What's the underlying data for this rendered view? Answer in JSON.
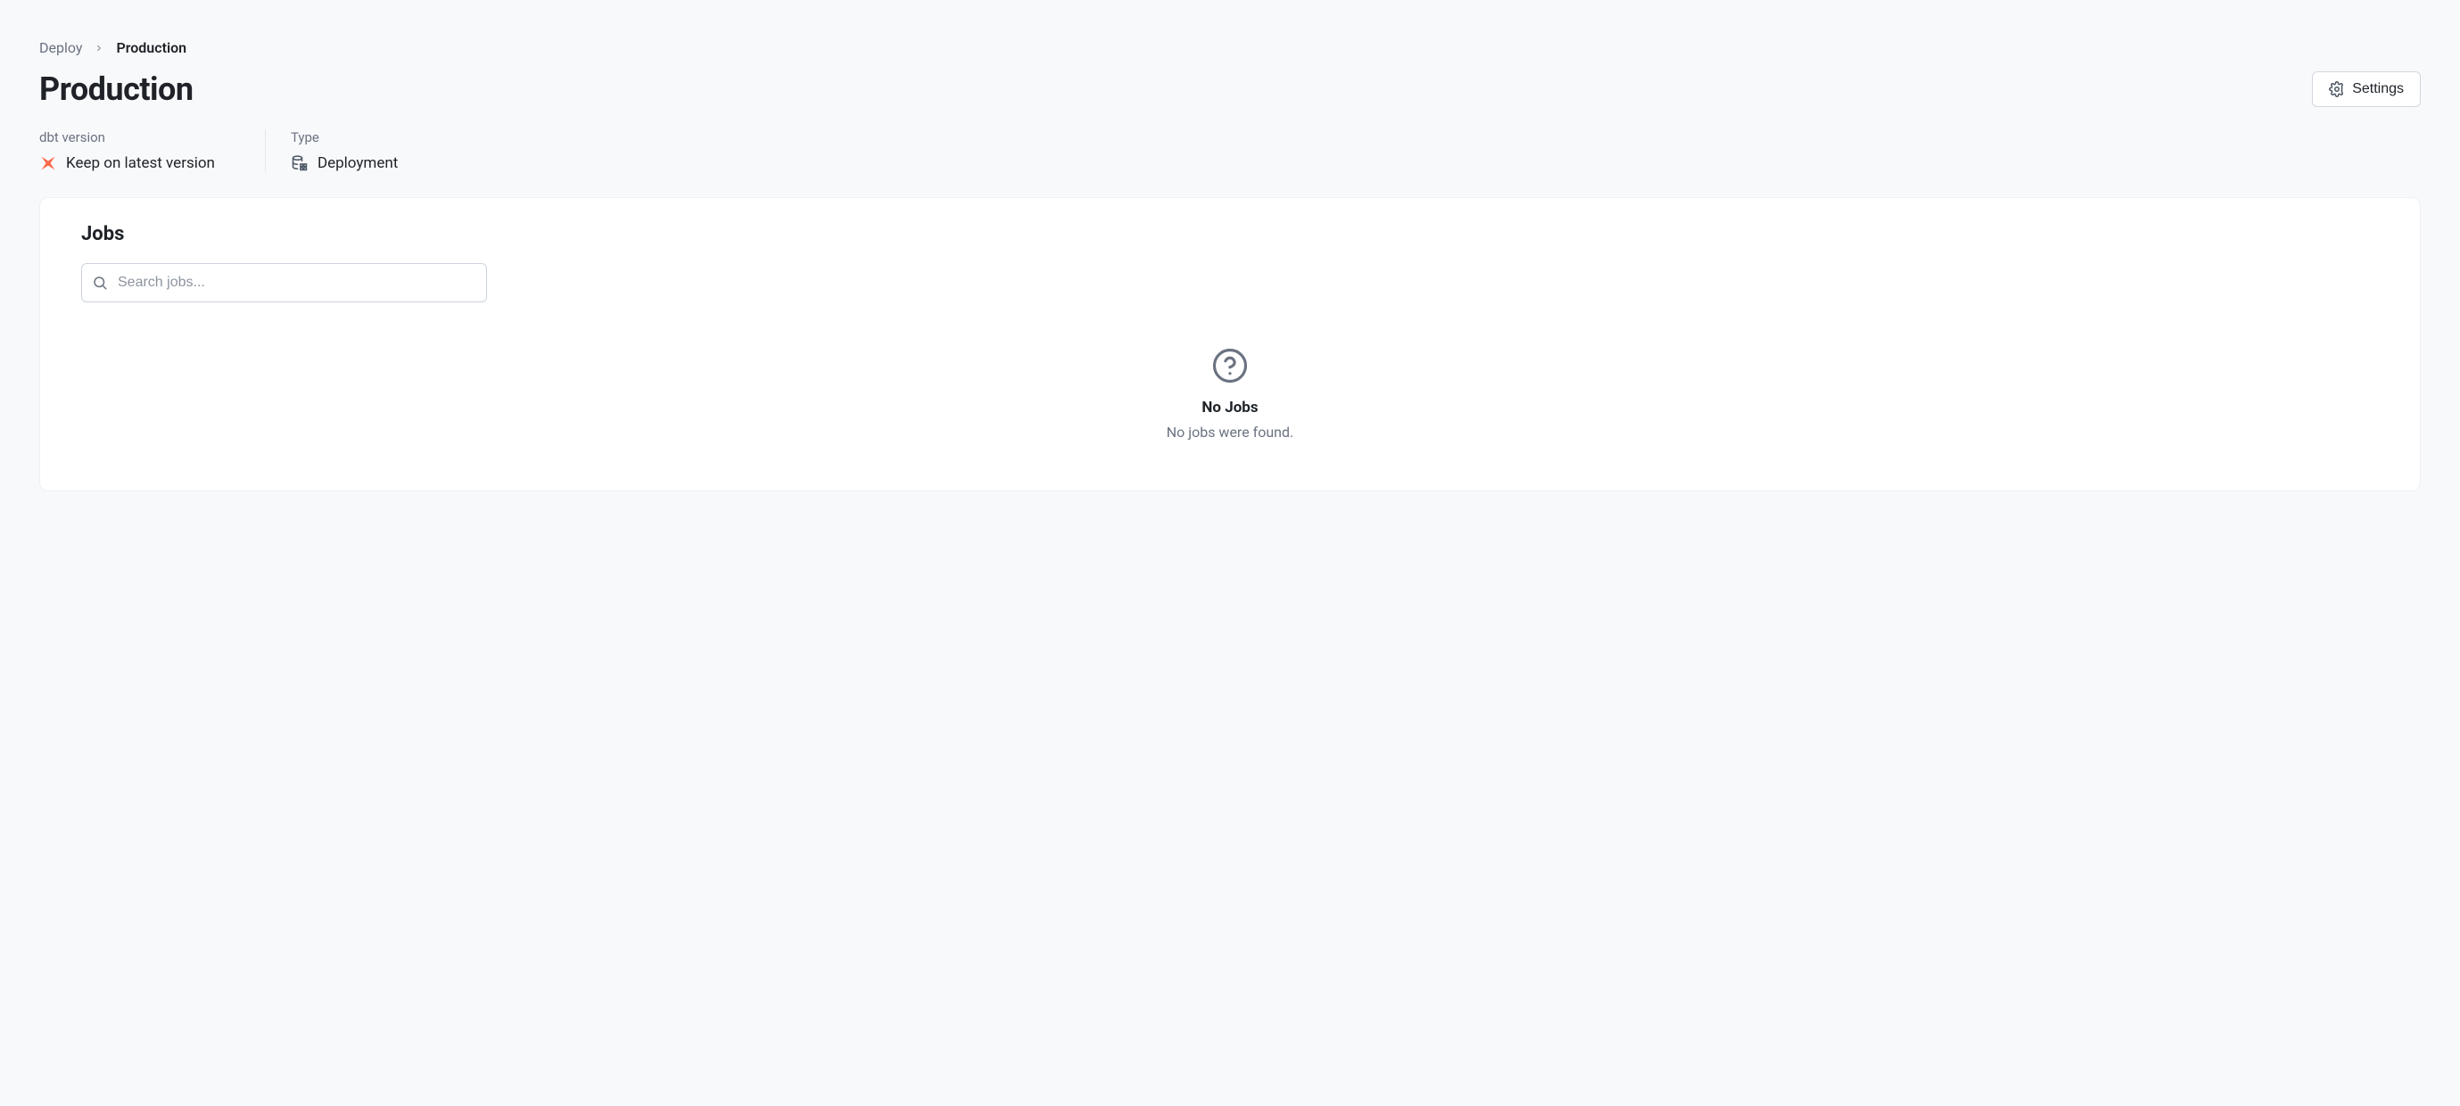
{
  "breadcrumb": {
    "parent": "Deploy",
    "current": "Production"
  },
  "title": "Production",
  "settings": {
    "label": "Settings"
  },
  "meta": {
    "dbt_version": {
      "label": "dbt version",
      "value": "Keep on latest version"
    },
    "type": {
      "label": "Type",
      "value": "Deployment"
    }
  },
  "jobs": {
    "title": "Jobs",
    "search_placeholder": "Search jobs...",
    "empty": {
      "title": "No Jobs",
      "description": "No jobs were found."
    }
  }
}
